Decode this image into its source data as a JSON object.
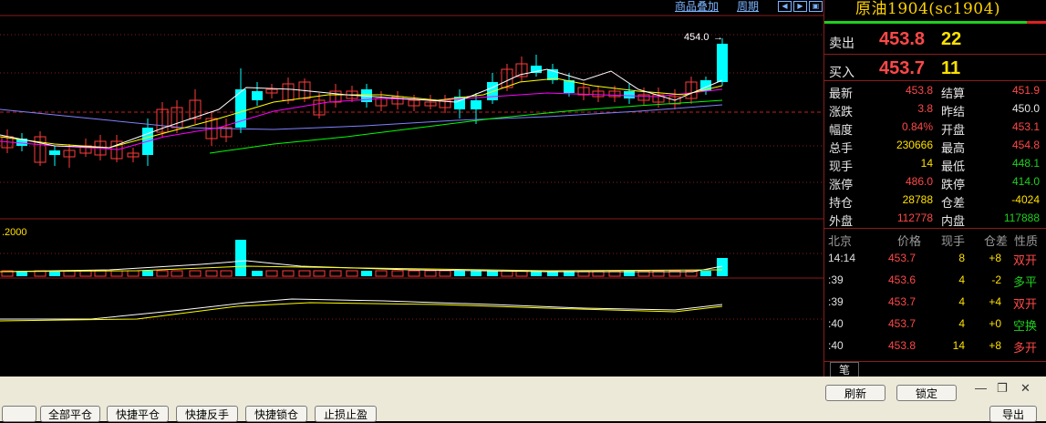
{
  "toolbar": {
    "overlay_label": "商品叠加",
    "period_label": "周期"
  },
  "chart": {
    "high_marker": "454.0",
    "volume_scale": ".2000",
    "colors": {
      "up": "#ff3b3b",
      "down": "#00ffff",
      "ma5": "#ffffff",
      "ma10": "#ffff00",
      "ma20": "#ff00ff",
      "ma60": "#00ff00",
      "ma120": "#8080ff"
    }
  },
  "panel": {
    "title": "原油1904(sc1904)",
    "ask": {
      "label": "卖出",
      "price": "453.8",
      "volume": "22"
    },
    "bid": {
      "label": "买入",
      "price": "453.7",
      "volume": "11"
    },
    "quotes": [
      {
        "l1": "最新",
        "v1": "453.8",
        "c1": "#ff4848",
        "l2": "结算",
        "v2": "451.9",
        "c2": "#ff4848"
      },
      {
        "l1": "涨跌",
        "v1": "3.8",
        "c1": "#ff4848",
        "l2": "昨结",
        "v2": "450.0",
        "c2": "#e6e6e6"
      },
      {
        "l1": "幅度",
        "v1": "0.84%",
        "c1": "#ff4848",
        "l2": "开盘",
        "v2": "453.1",
        "c2": "#ff4848"
      },
      {
        "l1": "总手",
        "v1": "230666",
        "c1": "#ffe000",
        "l2": "最高",
        "v2": "454.8",
        "c2": "#ff4848"
      },
      {
        "l1": "现手",
        "v1": "14",
        "c1": "#ffe000",
        "l2": "最低",
        "v2": "448.1",
        "c2": "#1ed11e"
      },
      {
        "l1": "涨停",
        "v1": "486.0",
        "c1": "#ff4848",
        "l2": "跌停",
        "v2": "414.0",
        "c2": "#1ed11e"
      },
      {
        "l1": "持仓",
        "v1": "28788",
        "c1": "#ffe000",
        "l2": "仓差",
        "v2": "-4024",
        "c2": "#ffe000"
      },
      {
        "l1": "外盘",
        "v1": "112778",
        "c1": "#ff4848",
        "l2": "内盘",
        "v2": "117888",
        "c2": "#1ed11e"
      }
    ],
    "trade_headers": {
      "time": "北京",
      "price": "价格",
      "volume": "现手",
      "oi_change": "仓差",
      "nature": "性质"
    },
    "trades": [
      {
        "time": "14:14",
        "price": "453.7",
        "volume": "8",
        "oi_change": "+8",
        "nature": "双开",
        "nature_color": "#ff4848"
      },
      {
        "time": ":39",
        "price": "453.6",
        "volume": "4",
        "oi_change": "-2",
        "nature": "多平",
        "nature_color": "#1ed11e"
      },
      {
        "time": ":39",
        "price": "453.7",
        "volume": "4",
        "oi_change": "+4",
        "nature": "双开",
        "nature_color": "#ff4848"
      },
      {
        "time": ":40",
        "price": "453.7",
        "volume": "4",
        "oi_change": "+0",
        "nature": "空换",
        "nature_color": "#1ed11e"
      },
      {
        "time": ":40",
        "price": "453.8",
        "volume": "14",
        "oi_change": "+8",
        "nature": "多开",
        "nature_color": "#ff4848"
      }
    ],
    "tab_label": "笔"
  },
  "bottom": {
    "refresh": "刷新",
    "lock": "锁定",
    "close_all": "全部平仓",
    "quick_close": "快捷平仓",
    "quick_reverse": "快捷反手",
    "quick_lock": "快捷锁仓",
    "stop_loss": "止损止盈",
    "exit": "导出"
  }
}
